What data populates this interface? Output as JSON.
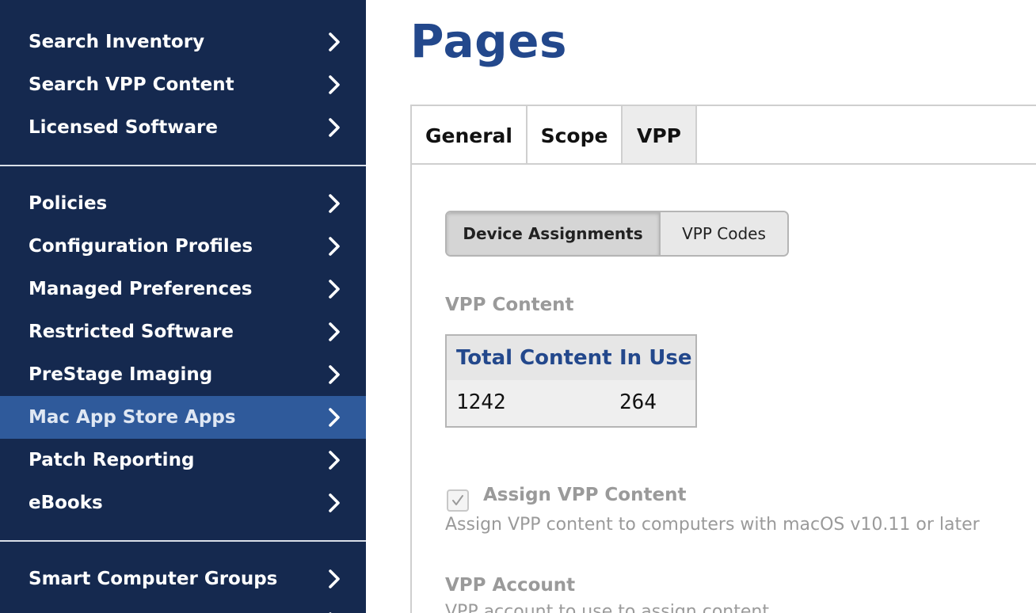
{
  "sidebar": {
    "items": [
      {
        "label": "Search Inventory"
      },
      {
        "label": "Search VPP Content"
      },
      {
        "label": "Licensed Software"
      },
      {
        "label": "Policies"
      },
      {
        "label": "Configuration Profiles"
      },
      {
        "label": "Managed Preferences"
      },
      {
        "label": "Restricted Software"
      },
      {
        "label": "PreStage Imaging"
      },
      {
        "label": "Mac App Store Apps"
      },
      {
        "label": "Patch Reporting"
      },
      {
        "label": "eBooks"
      },
      {
        "label": "Smart Computer Groups"
      }
    ],
    "active_item": "Mac App Store Apps",
    "chevron_icon": "chevron-right-icon"
  },
  "main": {
    "title": "Pages",
    "tabs": [
      {
        "label": "General"
      },
      {
        "label": "Scope"
      },
      {
        "label": "VPP"
      }
    ],
    "active_tab": "VPP",
    "segments": [
      {
        "label": "Device Assignments"
      },
      {
        "label": "VPP Codes"
      }
    ],
    "active_segment": "Device Assignments",
    "vpp_content": {
      "label": "VPP Content",
      "columns": [
        "Total Content",
        "In Use"
      ],
      "values": [
        "1242",
        "264"
      ]
    },
    "assign": {
      "label": "Assign VPP Content",
      "checked": true,
      "description": "Assign VPP content to computers with macOS v10.11 or later"
    },
    "account": {
      "label": "VPP Account",
      "description": "VPP account to use to assign content"
    }
  },
  "colors": {
    "sidebar_bg": "#15294f",
    "sidebar_active": "#2f5a9b",
    "title_blue": "#23488c",
    "muted_gray": "#9a9a9a"
  }
}
